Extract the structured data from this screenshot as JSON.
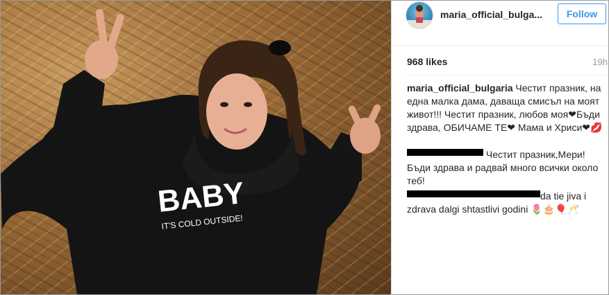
{
  "post": {
    "username": "maria_official_bulgaria",
    "username_display": "maria_official_bulga...",
    "follow_label": "Follow",
    "likes": "968 likes",
    "time": "19h",
    "photo_shirt_text": "BABY",
    "photo_shirt_subtext": "IT'S COLD OUTSIDE!"
  },
  "comments": [
    {
      "username": "maria_official_bulgaria",
      "text": " Честит празник, на една малка дама, даваща смисъл на моят живот!!! Честит празник, любов моя❤Бъди здрава, ОБИЧАМЕ ТЕ❤ Мама и Хриси❤💋"
    },
    {
      "username_redacted": true,
      "text": "Честит празник,Мери! Бъди здрава и радвай много всички около теб!"
    },
    {
      "username_redacted": true,
      "text": "da tie jiva i zdrava dalgi shtastlivi godini 🌷🎂🎈🥂"
    }
  ],
  "colors": {
    "accent": "#3897f0",
    "text": "#262626",
    "muted": "#999999",
    "border": "#dbdbdb"
  }
}
